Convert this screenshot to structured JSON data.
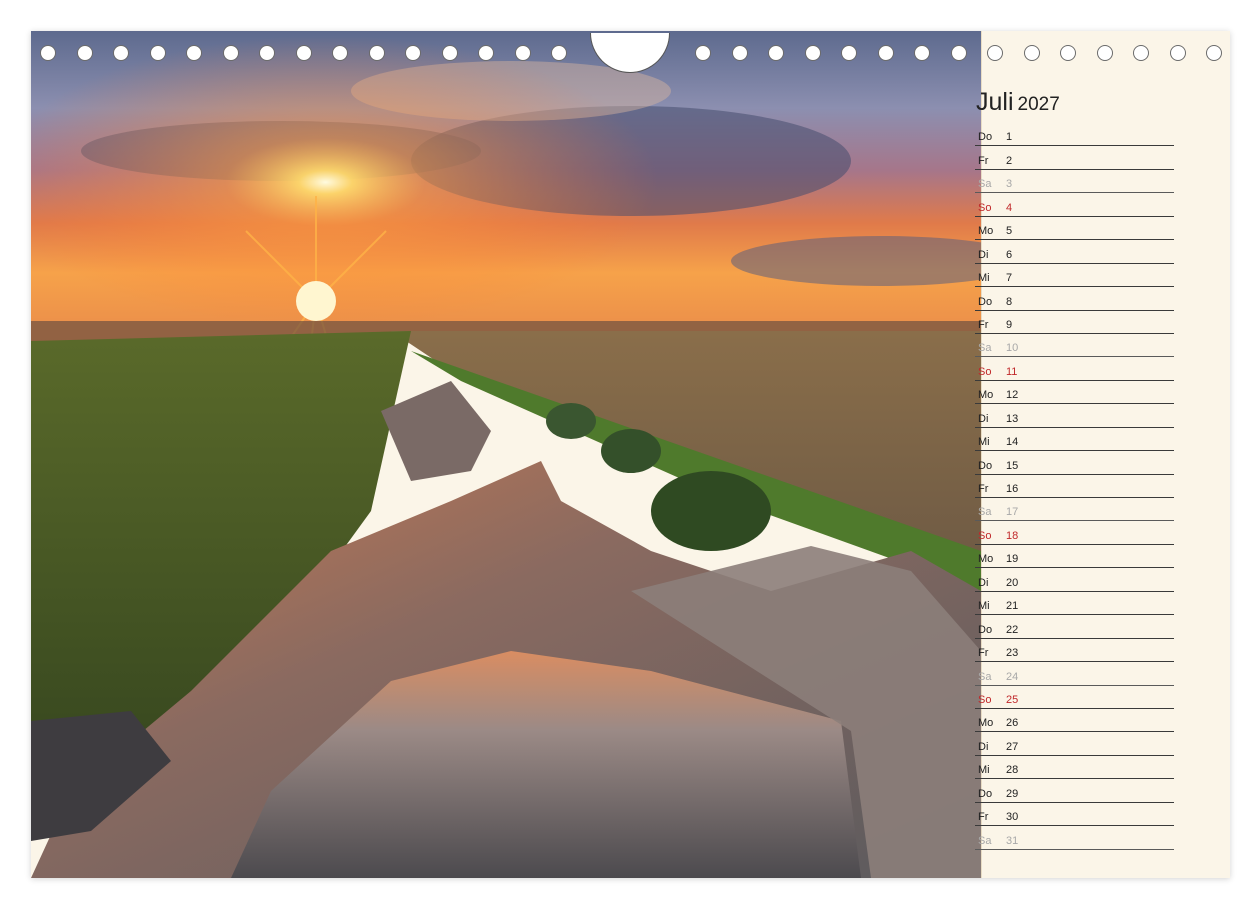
{
  "calendar": {
    "month": "Juli",
    "year": "2027",
    "days": [
      {
        "wd": "Do",
        "d": "1",
        "type": "weekday"
      },
      {
        "wd": "Fr",
        "d": "2",
        "type": "weekday"
      },
      {
        "wd": "Sa",
        "d": "3",
        "type": "saturday"
      },
      {
        "wd": "So",
        "d": "4",
        "type": "sunday"
      },
      {
        "wd": "Mo",
        "d": "5",
        "type": "weekday"
      },
      {
        "wd": "Di",
        "d": "6",
        "type": "weekday"
      },
      {
        "wd": "Mi",
        "d": "7",
        "type": "weekday"
      },
      {
        "wd": "Do",
        "d": "8",
        "type": "weekday"
      },
      {
        "wd": "Fr",
        "d": "9",
        "type": "weekday"
      },
      {
        "wd": "Sa",
        "d": "10",
        "type": "saturday"
      },
      {
        "wd": "So",
        "d": "11",
        "type": "sunday"
      },
      {
        "wd": "Mo",
        "d": "12",
        "type": "weekday"
      },
      {
        "wd": "Di",
        "d": "13",
        "type": "weekday"
      },
      {
        "wd": "Mi",
        "d": "14",
        "type": "weekday"
      },
      {
        "wd": "Do",
        "d": "15",
        "type": "weekday"
      },
      {
        "wd": "Fr",
        "d": "16",
        "type": "weekday"
      },
      {
        "wd": "Sa",
        "d": "17",
        "type": "saturday"
      },
      {
        "wd": "So",
        "d": "18",
        "type": "sunday"
      },
      {
        "wd": "Mo",
        "d": "19",
        "type": "weekday"
      },
      {
        "wd": "Di",
        "d": "20",
        "type": "weekday"
      },
      {
        "wd": "Mi",
        "d": "21",
        "type": "weekday"
      },
      {
        "wd": "Do",
        "d": "22",
        "type": "weekday"
      },
      {
        "wd": "Fr",
        "d": "23",
        "type": "weekday"
      },
      {
        "wd": "Sa",
        "d": "24",
        "type": "saturday"
      },
      {
        "wd": "So",
        "d": "25",
        "type": "sunday"
      },
      {
        "wd": "Mo",
        "d": "26",
        "type": "weekday"
      },
      {
        "wd": "Di",
        "d": "27",
        "type": "weekday"
      },
      {
        "wd": "Mi",
        "d": "28",
        "type": "weekday"
      },
      {
        "wd": "Do",
        "d": "29",
        "type": "weekday"
      },
      {
        "wd": "Fr",
        "d": "30",
        "type": "weekday"
      },
      {
        "wd": "Sa",
        "d": "31",
        "type": "saturday"
      }
    ]
  },
  "colors": {
    "paper": "#fbf5e8",
    "sunday": "#c0282a",
    "saturday": "#a8a8a8",
    "rule": "#3a3a3a"
  },
  "photo": {
    "subject": "sunset-over-rocky-ridge-landscape"
  }
}
